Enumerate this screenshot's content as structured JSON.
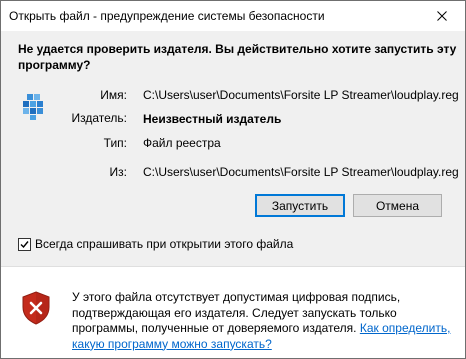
{
  "window": {
    "title": "Открыть файл - предупреждение системы безопасности"
  },
  "question": "Не удается проверить издателя. Вы действительно хотите запустить эту программу?",
  "details": {
    "name_label": "Имя:",
    "name_value": "C:\\Users\\user\\Documents\\Forsite LP Streamer\\loudplay.reg",
    "publisher_label": "Издатель:",
    "publisher_value": "Неизвестный издатель",
    "type_label": "Тип:",
    "type_value": "Файл реестра",
    "from_label": "Из:",
    "from_value": "C:\\Users\\user\\Documents\\Forsite LP Streamer\\loudplay.reg"
  },
  "buttons": {
    "run": "Запустить",
    "cancel": "Отмена"
  },
  "checkbox": {
    "label": "Всегда спрашивать при открытии этого файла",
    "checked": true
  },
  "warning": {
    "text": "У этого файла отсутствует допустимая цифровая подпись, подтверждающая его издателя.  Следует запускать только программы, полученные от доверяемого издателя.",
    "link": "Как определить, какую программу можно запускать?"
  },
  "colors": {
    "accent": "#0078d7",
    "link": "#0066cc",
    "shield_red": "#c42b1c"
  }
}
